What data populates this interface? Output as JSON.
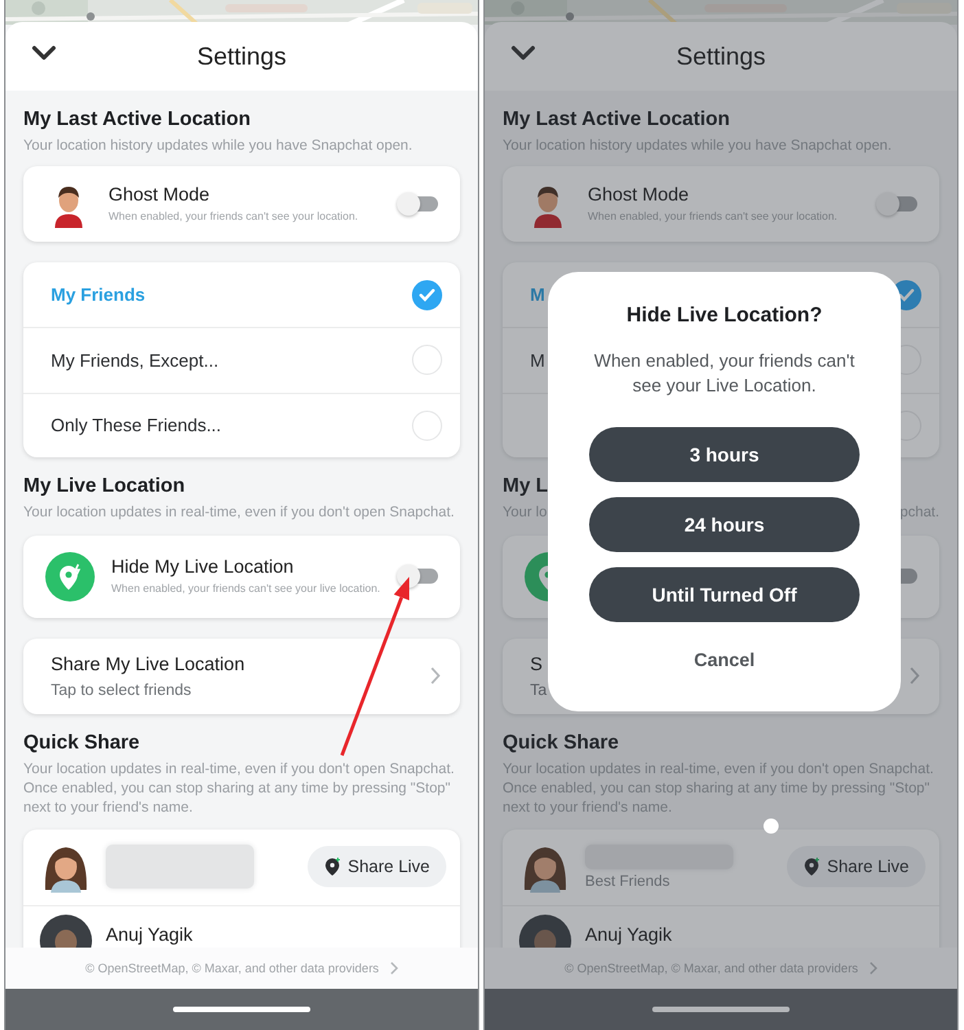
{
  "panels": [
    {
      "header": {
        "title": "Settings"
      },
      "sections": [
        {
          "title": "My Last Active Location",
          "subtitle": "Your location history updates while you have Snapchat open.",
          "cards": [
            {
              "kind": "toggle",
              "title": "Ghost Mode",
              "desc": "When enabled, your friends can't see your location.",
              "on": false
            },
            {
              "kind": "choices",
              "options": [
                {
                  "label": "My Friends",
                  "selected": true
                },
                {
                  "label": "My Friends, Except...",
                  "selected": false
                },
                {
                  "label": "Only These Friends...",
                  "selected": false
                }
              ]
            }
          ]
        },
        {
          "title": "My Live Location",
          "subtitle": "Your location updates in real-time, even if you don't open Snapchat.",
          "cards": [
            {
              "kind": "toggle",
              "title": "Hide My Live Location",
              "desc": "When enabled, your friends can't see your live location.",
              "on": false
            },
            {
              "kind": "link",
              "title": "Share My Live Location",
              "desc": "Tap to select friends"
            }
          ]
        },
        {
          "title": "Quick Share",
          "subtitle": "Your location updates in real-time, even if you don't open Snapchat. Once enabled, you can stop sharing at any time by pressing \"Stop\" next to your friend's name.",
          "cards": [
            {
              "kind": "friends",
              "friends": [
                {
                  "redacted": true,
                  "button": "Share Live"
                },
                {
                  "name": "Anuj Yagik"
                }
              ]
            }
          ]
        }
      ],
      "footer": {
        "text": "© OpenStreetMap, © Maxar, and other data providers"
      },
      "annotation_arrow": true
    },
    {
      "header": {
        "title": "Settings"
      },
      "sections": [
        {
          "title": "My Last Active Location",
          "subtitle": "Your location history updates while you have Snapchat open.",
          "cards": [
            {
              "kind": "toggle",
              "title": "Ghost Mode",
              "desc": "When enabled, your friends can't see your location.",
              "on": false
            },
            {
              "kind": "choices",
              "options": [
                {
                  "label": "M",
                  "selected": true
                },
                {
                  "label": "M",
                  "selected": false
                },
                {
                  "selected": false
                }
              ]
            }
          ]
        },
        {
          "title": "My L",
          "subtitle": [
            "Your lo",
            "pchat."
          ],
          "cards": [
            {
              "kind": "toggle",
              "on": false
            },
            {
              "kind": "link",
              "title": "S",
              "desc": "Ta"
            }
          ]
        },
        {
          "title": "Quick Share",
          "subtitle": "Your location updates in real-time, even if you don't open Snapchat. Once enabled, you can stop sharing at any time by pressing \"Stop\" next to your friend's name.",
          "cards": [
            {
              "kind": "friends",
              "friends": [
                {
                  "redacted": true,
                  "subtitle": "Best Friends",
                  "button": "Share Live"
                },
                {
                  "name": "Anuj Yagik"
                }
              ]
            }
          ]
        }
      ],
      "footer": {
        "text": "© OpenStreetMap, © Maxar, and other data providers"
      },
      "dialog": {
        "title": "Hide Live Location?",
        "message": "When enabled, your friends can't see your Live Location.",
        "options": [
          "3 hours",
          "24 hours",
          "Until Turned Off"
        ],
        "cancel": "Cancel"
      },
      "touch_indicator": true
    }
  ]
}
